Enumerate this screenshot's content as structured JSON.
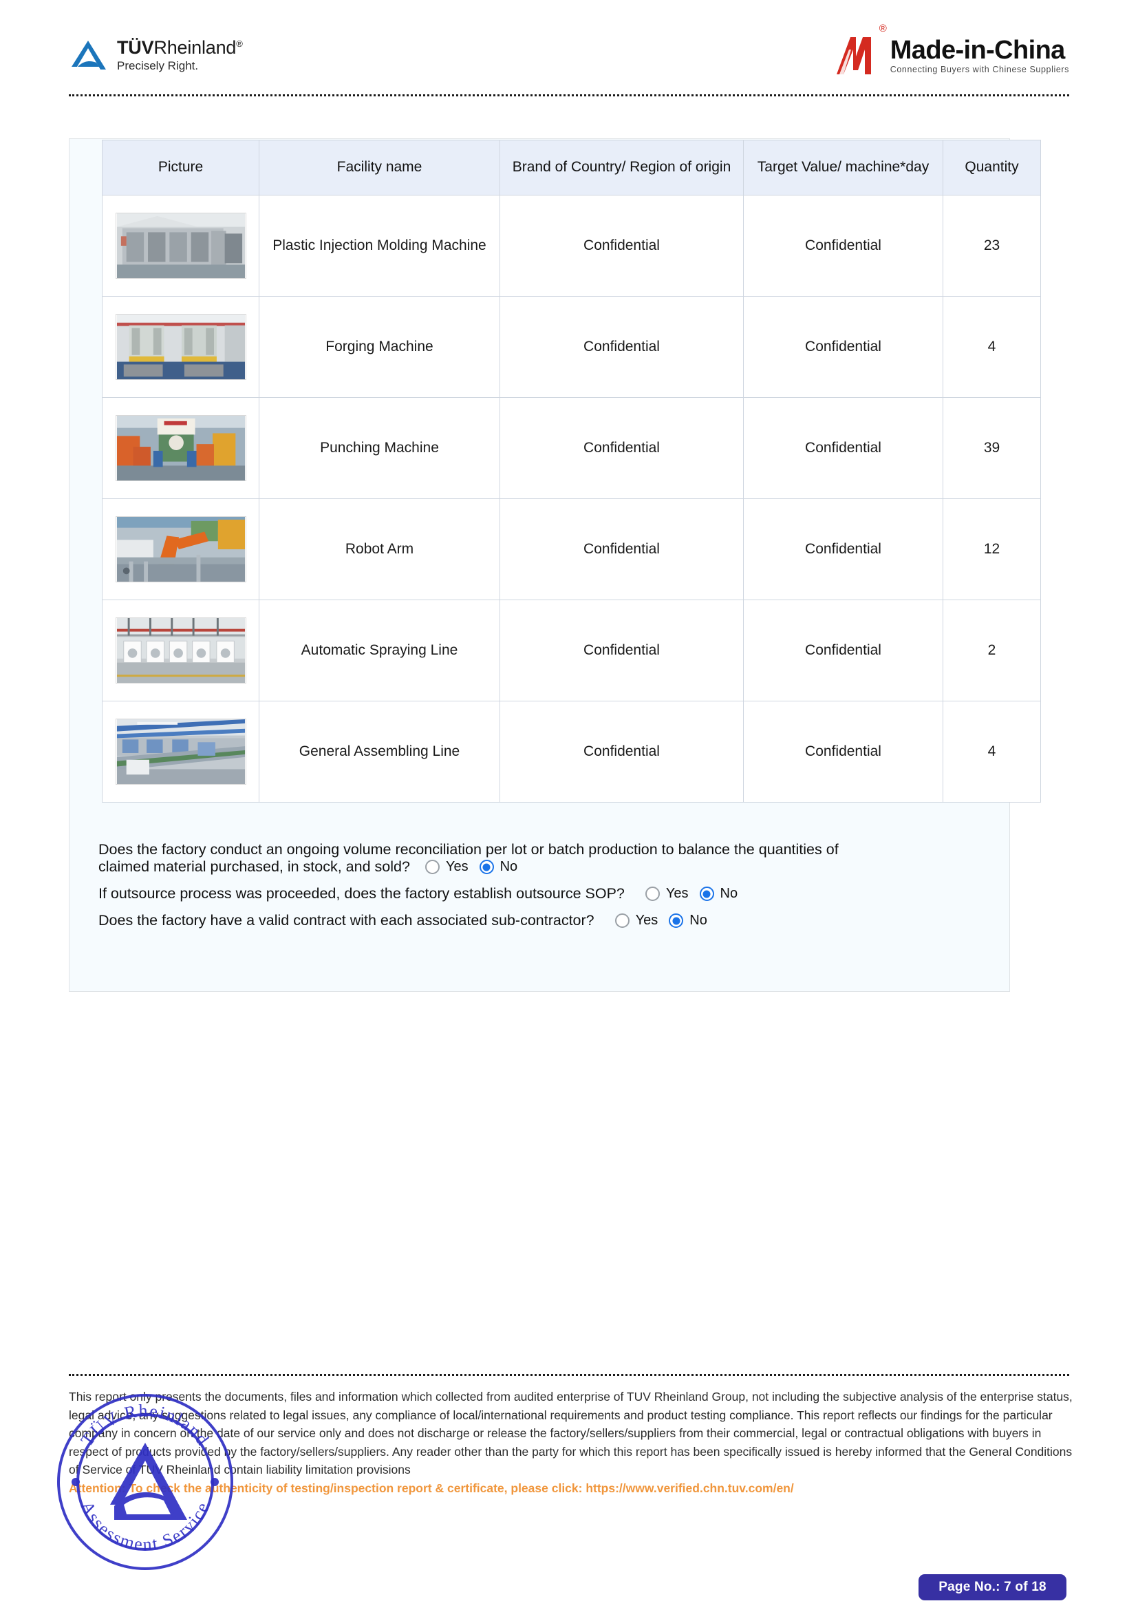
{
  "header": {
    "tuv": {
      "name_bold": "TÜV",
      "name_rest": "Rheinland",
      "registered": "®",
      "tagline": "Precisely Right."
    },
    "mic": {
      "name": "Made-in-China",
      "registered": "®",
      "tagline": "Connecting Buyers with Chinese Suppliers"
    }
  },
  "table": {
    "columns": [
      {
        "label": "Picture"
      },
      {
        "label": "Facility name"
      },
      {
        "label": "Brand of Country/ Region of origin"
      },
      {
        "label": "Target Value/ machine*day"
      },
      {
        "label": "Quantity"
      }
    ],
    "rows": [
      {
        "picture": "plastic-injection-molding-machine-photo",
        "facility_name": "Plastic Injection Molding Machine",
        "brand_origin": "Confidential",
        "target_value": "Confidential",
        "quantity": "23"
      },
      {
        "picture": "forging-machine-photo",
        "facility_name": "Forging Machine",
        "brand_origin": "Confidential",
        "target_value": "Confidential",
        "quantity": "4"
      },
      {
        "picture": "punching-machine-photo",
        "facility_name": "Punching Machine",
        "brand_origin": "Confidential",
        "target_value": "Confidential",
        "quantity": "39"
      },
      {
        "picture": "robot-arm-photo",
        "facility_name": "Robot Arm",
        "brand_origin": "Confidential",
        "target_value": "Confidential",
        "quantity": "12"
      },
      {
        "picture": "automatic-spraying-line-photo",
        "facility_name": "Automatic Spraying Line",
        "brand_origin": "Confidential",
        "target_value": "Confidential",
        "quantity": "2"
      },
      {
        "picture": "general-assembling-line-photo",
        "facility_name": "General Assembling Line",
        "brand_origin": "Confidential",
        "target_value": "Confidential",
        "quantity": "4"
      }
    ]
  },
  "questions": [
    {
      "text_line1": "Does the factory conduct an ongoing volume reconciliation per lot or batch production to balance the quantities of",
      "text_line2": "claimed material purchased, in stock, and sold?",
      "yes_label": "Yes",
      "no_label": "No",
      "selected": "No"
    },
    {
      "text_line1": "If outsource process was proceeded, does the factory establish outsource SOP?",
      "text_line2": "",
      "yes_label": "Yes",
      "no_label": "No",
      "selected": "No"
    },
    {
      "text_line1": "Does the factory have a valid contract with each associated sub-contractor?",
      "text_line2": "",
      "yes_label": "Yes",
      "no_label": "No",
      "selected": "No"
    }
  ],
  "footer": {
    "disclaimer": "This report only presents the documents, files and information which collected from audited enterprise of TUV Rheinland Group, not including the subjective analysis of the enterprise status, legal advice, any suggestions related to legal issues, any compliance of local/international requirements and product testing compliance. This report reflects our findings for the particular company in concern on the date of our service only and does not discharge or release the factory/sellers/suppliers from their commercial, legal or contractual obligations with buyers in respect of products provided by the factory/sellers/suppliers. Any reader other than the party for which this report has been specifically issued is hereby informed that the General Conditions of Service of TUV Rheinland contain liability limitation provisions",
    "attention": "Attention: To check the authenticity of testing/inspection report & certificate, please click:  https://www.verified.chn.tuv.com/en/",
    "stamp_top_text": "TÜV Rheinland",
    "stamp_bottom_text": "Assessment Service",
    "page_label": "Page No.: 7 of 18"
  },
  "colors": {
    "tuv_blue": "#1b75bb",
    "mic_red": "#d42a20",
    "radio_selected": "#1a73e8",
    "attention_orange": "#f0963c",
    "badge_indigo": "#3730a3",
    "table_header_bg": "#e8eef9",
    "panel_bg": "#f6fbfe"
  }
}
